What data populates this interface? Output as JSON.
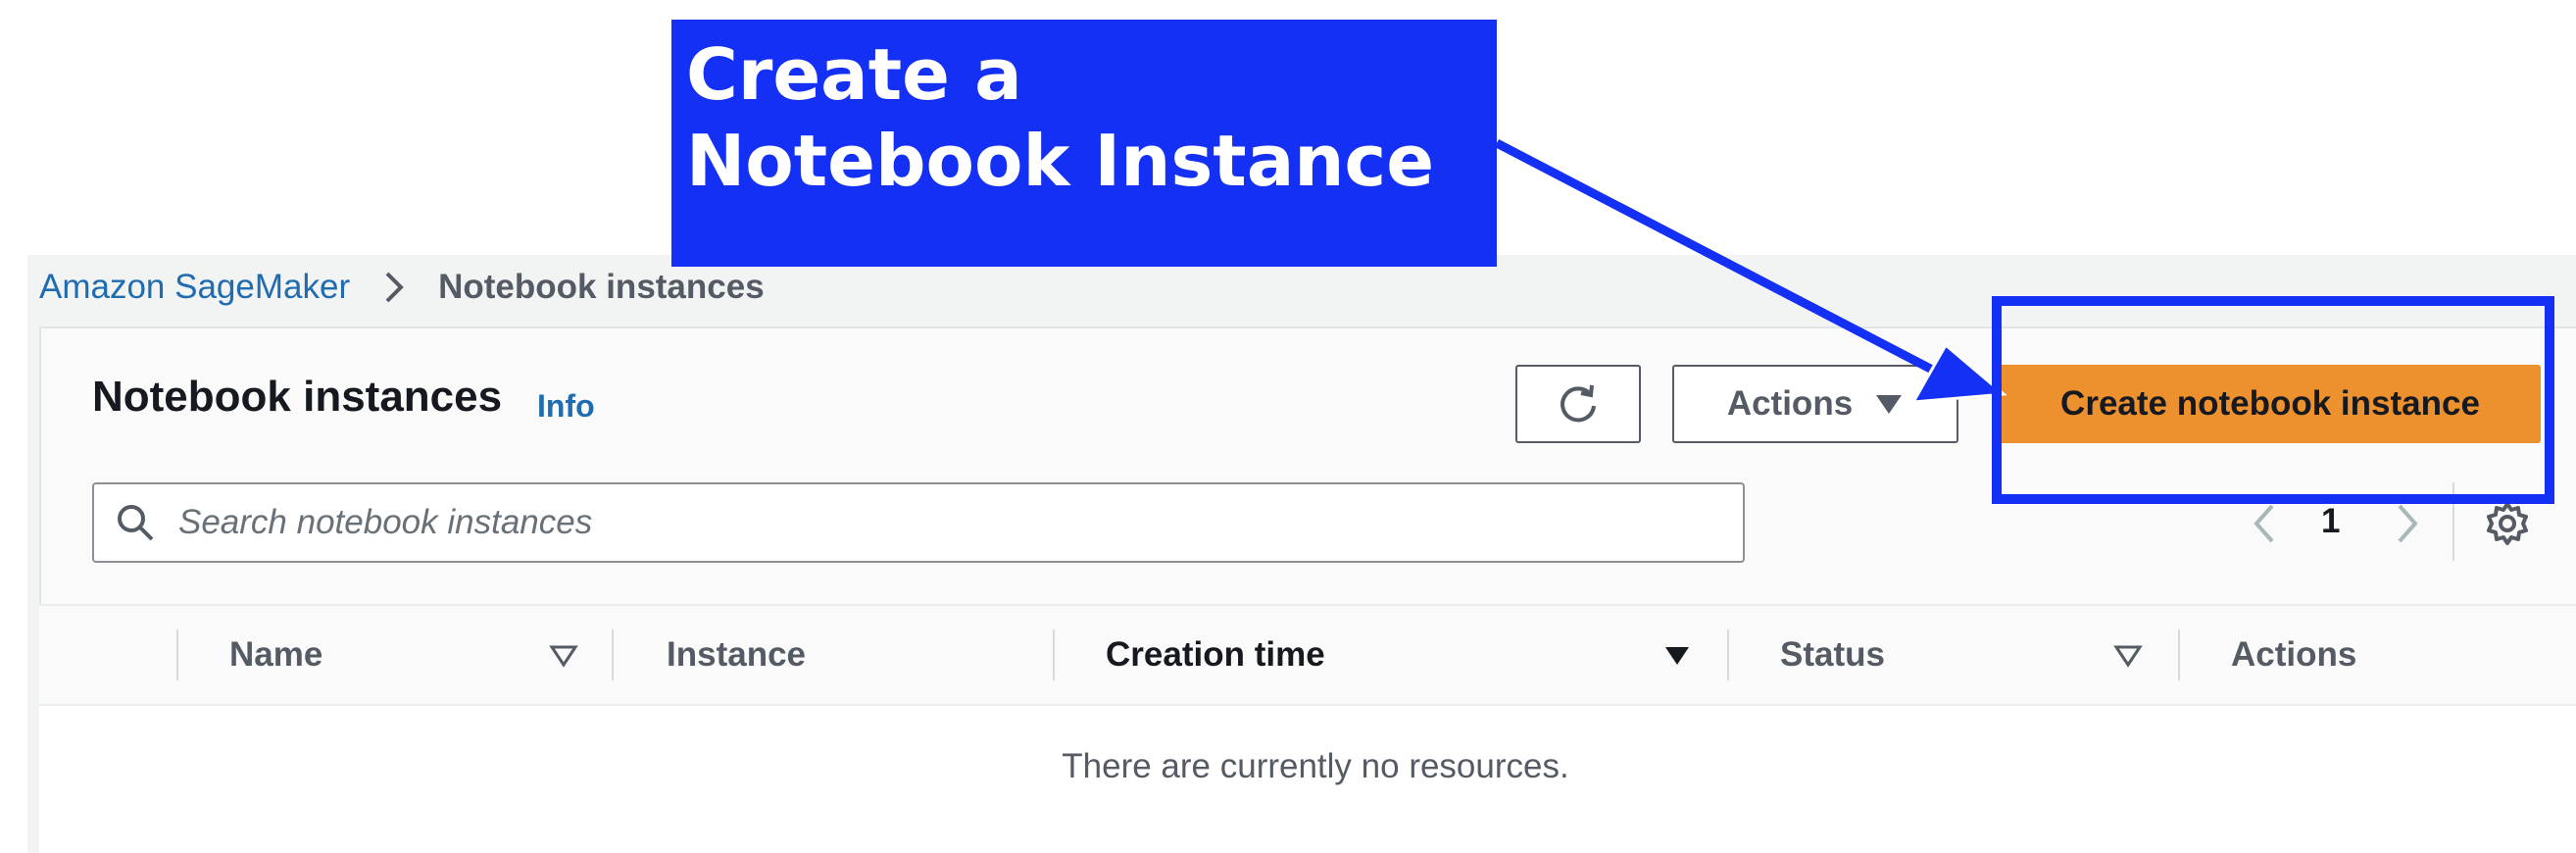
{
  "annotation": {
    "line1": "Create a",
    "line2": "Notebook Instance",
    "color": "#1530f5"
  },
  "breadcrumb": {
    "root": "Amazon SageMaker",
    "current": "Notebook instances"
  },
  "header": {
    "title": "Notebook instances",
    "info": "Info",
    "actions_label": "Actions",
    "create_label": "Create notebook instance",
    "create_color": "#ec912d"
  },
  "search": {
    "placeholder": "Search notebook instances"
  },
  "pagination": {
    "current_page": "1"
  },
  "table": {
    "columns": [
      {
        "label": "Name",
        "sort": "none"
      },
      {
        "label": "Instance",
        "sort": "none"
      },
      {
        "label": "Creation time",
        "sort": "descending"
      },
      {
        "label": "Status",
        "sort": "none"
      },
      {
        "label": "Actions",
        "sort": "none"
      }
    ],
    "empty_message": "There are currently no resources."
  },
  "icons": {
    "refresh": "refresh-icon",
    "dropdown": "caret-down-icon",
    "search": "search-icon",
    "prev": "chevron-left-icon",
    "next": "chevron-right-icon",
    "settings": "gear-icon"
  }
}
